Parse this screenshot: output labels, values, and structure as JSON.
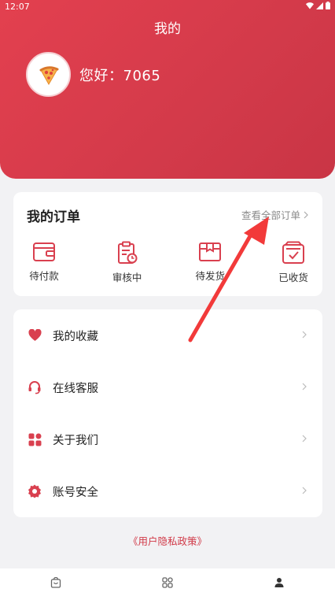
{
  "status": {
    "time": "12:07"
  },
  "header": {
    "title": "我的",
    "greeting": "您好：7065"
  },
  "orders": {
    "title": "我的订单",
    "view_all": "查看全部订单",
    "items": [
      {
        "label": "待付款",
        "icon": "wallet-icon"
      },
      {
        "label": "审核中",
        "icon": "clipboard-clock-icon"
      },
      {
        "label": "待发货",
        "icon": "box-icon"
      },
      {
        "label": "已收货",
        "icon": "received-check-icon"
      }
    ]
  },
  "menu": {
    "items": [
      {
        "label": "我的收藏",
        "icon": "heart-icon"
      },
      {
        "label": "在线客服",
        "icon": "headset-icon"
      },
      {
        "label": "关于我们",
        "icon": "apps-grid-icon"
      },
      {
        "label": "账号安全",
        "icon": "gear-icon"
      }
    ]
  },
  "footer": {
    "privacy": "《用户隐私政策》"
  },
  "tabs": [
    {
      "icon": "shop-bag-icon"
    },
    {
      "icon": "grid-icon"
    },
    {
      "icon": "user-icon"
    }
  ],
  "colors": {
    "accent": "#d9404f",
    "arrow": "#f23a3a"
  }
}
